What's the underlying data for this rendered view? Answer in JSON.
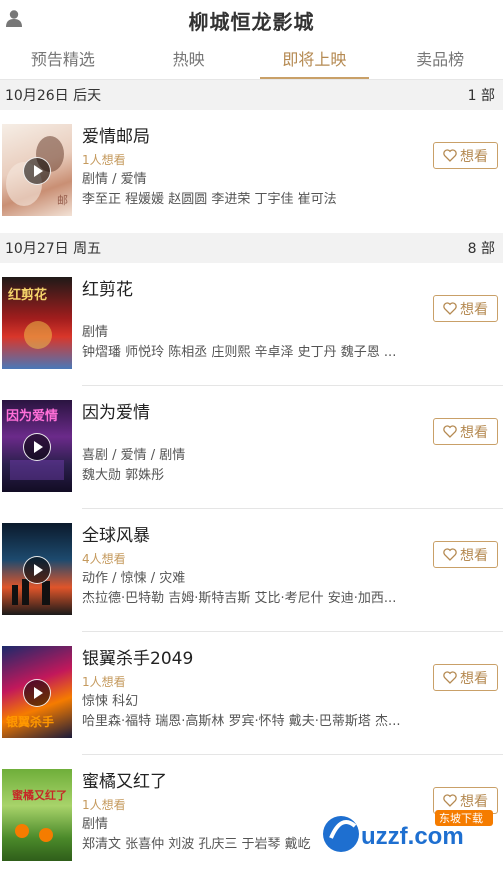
{
  "header": {
    "title": "柳城恒龙影城",
    "user_icon": "user-icon"
  },
  "tabs": [
    {
      "label": "预告精选",
      "active": false
    },
    {
      "label": "热映",
      "active": false
    },
    {
      "label": "即将上映",
      "active": true
    },
    {
      "label": "卖品榜",
      "active": false
    }
  ],
  "groups": [
    {
      "date": "10月26日 后天",
      "count": "1 部",
      "movies": [
        {
          "title": "爱情邮局",
          "want": "1人想看",
          "genre": "剧情 / 爱情",
          "cast": "李至正 程媛媛 赵圆圆 李进荣 丁宇佳 崔可法",
          "button": "想看"
        }
      ]
    },
    {
      "date": "10月27日 周五",
      "count": "8 部",
      "movies": [
        {
          "title": "红剪花",
          "want": "",
          "genre": "剧情",
          "cast": "钟熠璠 师悦玲 陈相丞 庄则熙 辛卓泽 史丁丹 魏子恩 ...",
          "button": "想看"
        },
        {
          "title": "因为爱情",
          "want": "",
          "genre": "喜剧 / 爱情 / 剧情",
          "cast": "魏大勋 郭姝彤",
          "button": "想看"
        },
        {
          "title": "全球风暴",
          "want": "4人想看",
          "genre": "动作 / 惊悚 / 灾难",
          "cast": "杰拉德·巴特勒 吉姆·斯特吉斯 艾比·考尼什 安迪·加西...",
          "button": "想看"
        },
        {
          "title": "银翼杀手2049",
          "want": "1人想看",
          "genre": "惊悚 科幻",
          "cast": "哈里森·福特 瑞恩·高斯林 罗宾·怀特 戴夫·巴蒂斯塔 杰...",
          "button": "想看"
        },
        {
          "title": "蜜橘又红了",
          "want": "1人想看",
          "genre": "剧情",
          "cast": "郑清文 张喜仲 刘波 孔庆三 于岩琴 戴屹",
          "button": "想看"
        }
      ]
    }
  ],
  "watermark": {
    "text": "uzzf.com",
    "badge": "东坡下载"
  },
  "colors": {
    "accent": "#c9a068",
    "accent_text": "#b58a52",
    "section_bg": "#f2f2f2"
  }
}
